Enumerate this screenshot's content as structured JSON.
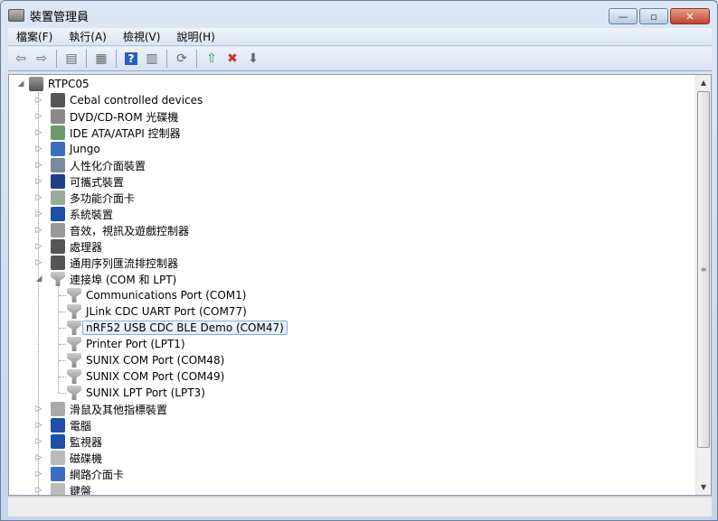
{
  "window": {
    "title": "裝置管理員",
    "minimize": "—",
    "maximize": "▫",
    "close": "✕"
  },
  "menu": [
    "檔案(F)",
    "執行(A)",
    "檢視(V)",
    "說明(H)"
  ],
  "toolbar": [
    {
      "icon": "back-icon",
      "glyph": "⇦"
    },
    {
      "icon": "forward-icon",
      "glyph": "⇨"
    },
    {
      "sep": true
    },
    {
      "icon": "show-hide-console-tree-icon",
      "glyph": "▤"
    },
    {
      "sep": true
    },
    {
      "icon": "properties-icon",
      "glyph": "▦"
    },
    {
      "sep": true
    },
    {
      "icon": "help-icon",
      "glyph": "?"
    },
    {
      "icon": "action-pane-icon",
      "glyph": "▥"
    },
    {
      "sep": true
    },
    {
      "icon": "scan-hardware-changes-icon",
      "glyph": "⟳"
    },
    {
      "sep": true
    },
    {
      "icon": "update-driver-icon",
      "glyph": "⇧"
    },
    {
      "icon": "uninstall-icon",
      "glyph": "✖"
    },
    {
      "icon": "disable-device-icon",
      "glyph": "⬇"
    }
  ],
  "tree": {
    "root": "RTPC05",
    "items": [
      {
        "label": "Cebal controlled devices",
        "icon": "usb-device-icon",
        "color": "#555"
      },
      {
        "label": "DVD/CD-ROM 光碟機",
        "icon": "dvd-drive-icon",
        "color": "#8a8a8a"
      },
      {
        "label": "IDE ATA/ATAPI 控制器",
        "icon": "ide-controller-icon",
        "color": "#6a9a6a"
      },
      {
        "label": "Jungo",
        "icon": "network-icon",
        "color": "#3a6fc0"
      },
      {
        "label": "人性化介面裝置",
        "icon": "hid-icon",
        "color": "#7a8a9a"
      },
      {
        "label": "可攜式裝置",
        "icon": "portable-device-icon",
        "color": "#1c3f8a"
      },
      {
        "label": "多功能介面卡",
        "icon": "multifunction-adapter-icon",
        "color": "#9aaa9a"
      },
      {
        "label": "系統裝置",
        "icon": "system-device-icon",
        "color": "#1f4fa8"
      },
      {
        "label": "音效，視訊及遊戲控制器",
        "icon": "speaker-icon",
        "color": "#999"
      },
      {
        "label": "處理器",
        "icon": "processor-icon",
        "color": "#555"
      },
      {
        "label": "通用序列匯流排控制器",
        "icon": "usb-controller-icon",
        "color": "#555"
      },
      {
        "label": "連接埠 (COM 和 LPT)",
        "icon": "port-icon",
        "color": "#9a9a9a",
        "expanded": true,
        "children": [
          {
            "label": "Communications Port (COM1)"
          },
          {
            "label": "JLink CDC UART Port (COM77)"
          },
          {
            "label": "nRF52 USB CDC BLE Demo (COM47)",
            "selected": true
          },
          {
            "label": "Printer Port (LPT1)"
          },
          {
            "label": "SUNIX COM Port (COM48)"
          },
          {
            "label": "SUNIX COM Port (COM49)"
          },
          {
            "label": "SUNIX LPT Port (LPT3)"
          }
        ]
      },
      {
        "label": "滑鼠及其他指標裝置",
        "icon": "mouse-icon",
        "color": "#aaa"
      },
      {
        "label": "電腦",
        "icon": "computer-icon",
        "color": "#1f4fa8"
      },
      {
        "label": "監視器",
        "icon": "monitor-icon",
        "color": "#1f4fa8"
      },
      {
        "label": "磁碟機",
        "icon": "disk-drive-icon",
        "color": "#bbb"
      },
      {
        "label": "網路介面卡",
        "icon": "network-adapter-icon",
        "color": "#3a6fc0"
      },
      {
        "label": "鍵盤",
        "icon": "keyboard-icon",
        "color": "#bbb"
      }
    ]
  }
}
